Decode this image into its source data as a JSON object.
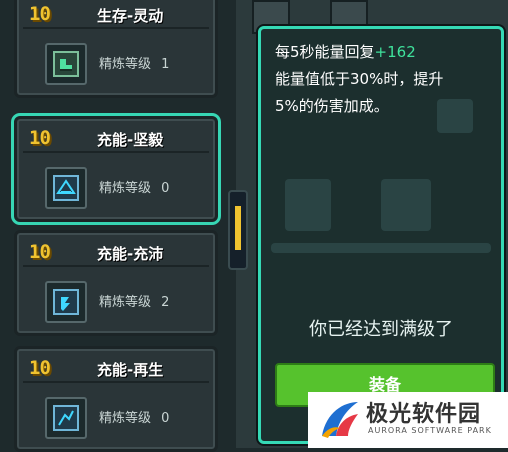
{
  "cards": [
    {
      "level": "10",
      "name": "生存-灵动",
      "refine_label": "精炼等级",
      "refine_level": "1",
      "icon": "boots-icon",
      "selected": false
    },
    {
      "level": "10",
      "name": "充能-坚毅",
      "refine_label": "精炼等级",
      "refine_level": "0",
      "icon": "shield-chip-icon",
      "selected": true
    },
    {
      "level": "10",
      "name": "充能-充沛",
      "refine_label": "精炼等级",
      "refine_level": "2",
      "icon": "energy-chip-icon",
      "selected": false
    },
    {
      "level": "10",
      "name": "充能-再生",
      "refine_label": "精炼等级",
      "refine_level": "0",
      "icon": "regen-chip-icon",
      "selected": false
    }
  ],
  "detail": {
    "line1_text": "每5秒能量回复",
    "line1_value": "+162",
    "line2": "能量值低于30%时，提升",
    "line3": "5%的伤害加成。",
    "maxed_text": "你已经达到满级了",
    "equip_label": "装备"
  },
  "watermark": {
    "main": "极光软件园",
    "sub": "AURORA SOFTWARE PARK"
  },
  "colors": {
    "accent_teal": "#35d9b5",
    "level_gold": "#f0c330",
    "value_green": "#3fe29c",
    "equip_green": "#56c22d"
  },
  "scroll_position": 0.35
}
